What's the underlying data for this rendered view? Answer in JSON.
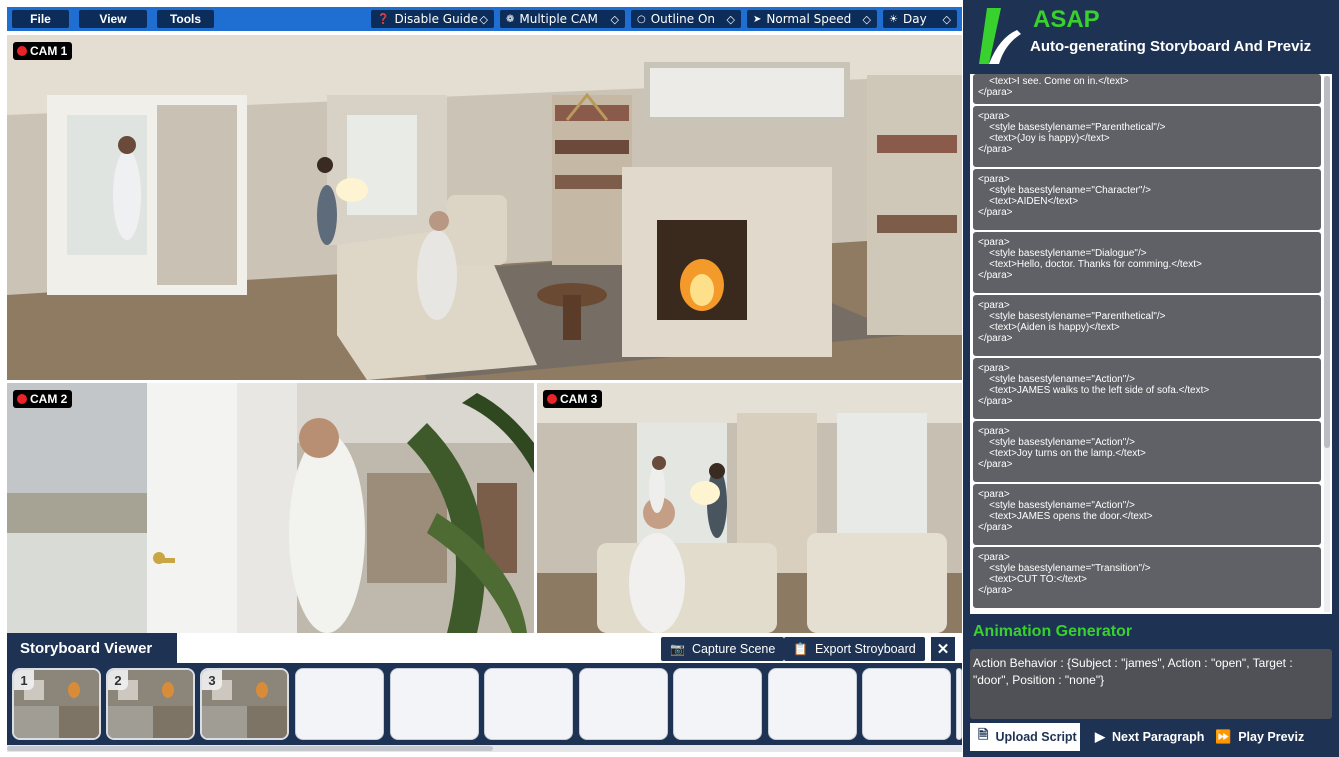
{
  "menu": {
    "file": "File",
    "view": "View",
    "tools": "Tools"
  },
  "toolbar": {
    "guide": "Disable Guide",
    "cam": "Multiple CAM",
    "outline": "Outline On",
    "speed": "Normal Speed",
    "time": "Day"
  },
  "cams": {
    "cam1": "CAM 1",
    "cam2": "CAM 2",
    "cam3": "CAM 3"
  },
  "storyboard": {
    "title": "Storyboard Viewer",
    "capture": "Capture Scene",
    "export": "Export Stroyboard",
    "thumbs": [
      "1",
      "2",
      "3"
    ]
  },
  "app": {
    "title": "ASAP",
    "subtitle": "Auto-generating Storyboard And Previz"
  },
  "script": {
    "first": "    <text>I see. Come on in.</text>\n</para>",
    "paras": [
      "<para>\n    <style basestylename=\"Parenthetical\"/>\n    <text>(Joy is happy)</text>\n</para>",
      "<para>\n    <style basestylename=\"Character\"/>\n    <text>AIDEN</text>\n</para>",
      "<para>\n    <style basestylename=\"Dialogue\"/>\n    <text>Hello, doctor. Thanks for comming.</text>\n</para>",
      "<para>\n    <style basestylename=\"Parenthetical\"/>\n    <text>(Aiden is happy)</text>\n</para>",
      "<para>\n    <style basestylename=\"Action\"/>\n    <text>JAMES walks to the left side of sofa.</text>\n</para>",
      "<para>\n    <style basestylename=\"Action\"/>\n    <text>Joy turns on the lamp.</text>\n</para>",
      "<para>\n    <style basestylename=\"Action\"/>\n    <text>JAMES opens the door.</text>\n</para>",
      "<para>\n    <style basestylename=\"Transition\"/>\n    <text>CUT TO:</text>\n</para>"
    ]
  },
  "animation": {
    "title": "Animation Generator",
    "text": "Action Behavior : {Subject : \"james\", Action : \"open\", Target : \"door\", Position : \"none\"}"
  },
  "buttons": {
    "upload": "Upload Script",
    "next": "Next Paragraph",
    "play": "Play Previz"
  },
  "colors": {
    "accent_blue": "#1e6fd1",
    "navy": "#1e3354",
    "green": "#38d12d",
    "rec_red": "#e8242a"
  }
}
